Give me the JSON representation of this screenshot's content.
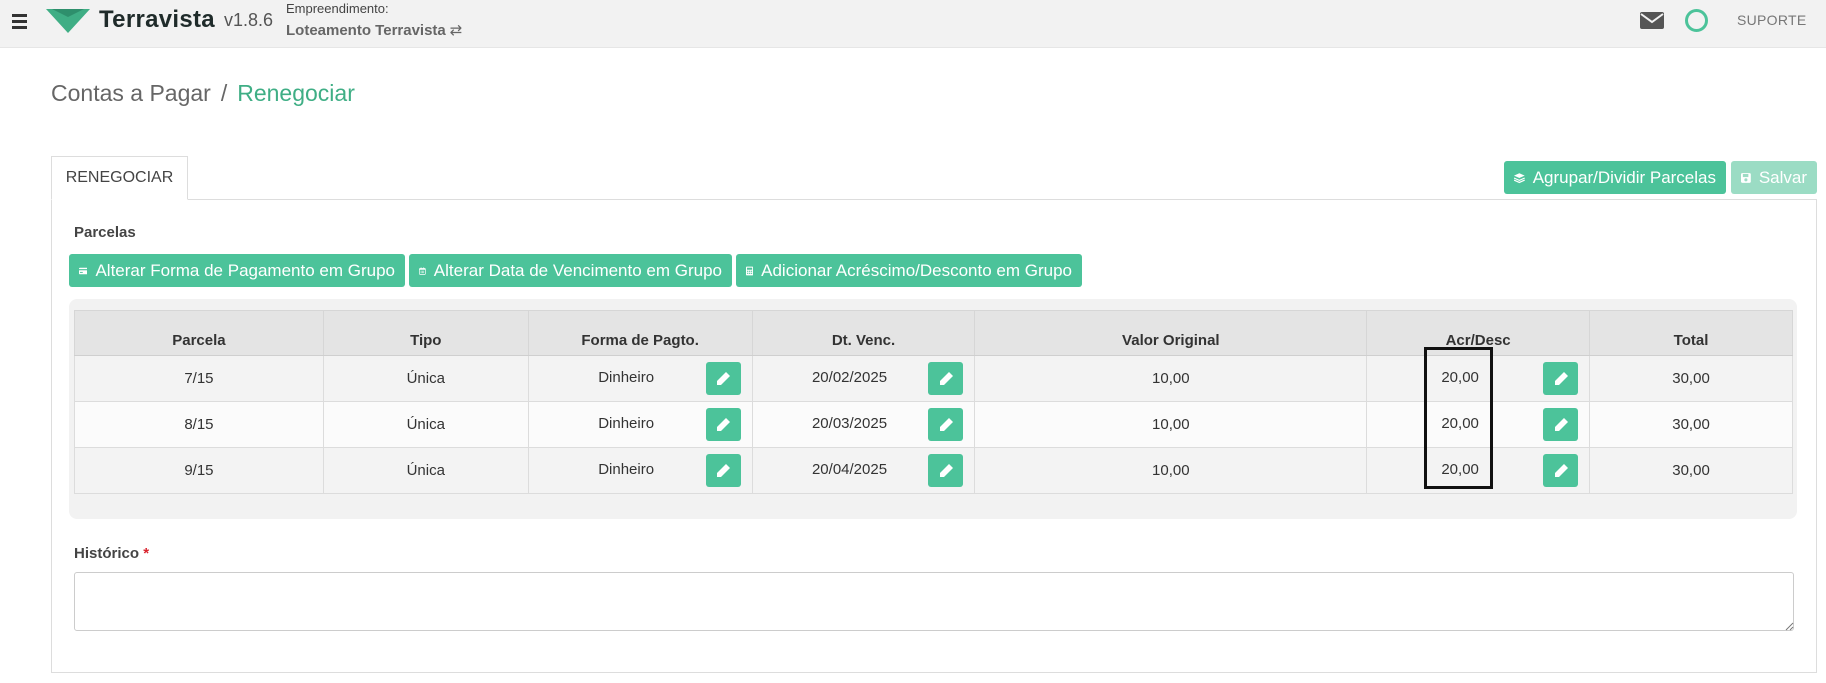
{
  "header": {
    "brand": "Terravista",
    "version": "v1.8.6",
    "empreendimento_label": "Empreendimento:",
    "empreendimento_name": "Loteamento Terravista",
    "swap_glyph": "⇄",
    "support_label": "SUPORTE",
    "accent": "#4cc39a"
  },
  "breadcrumb": {
    "parent": "Contas a Pagar",
    "separator": "/",
    "current": "Renegociar"
  },
  "tabs": [
    {
      "label": "RENEGOCIAR",
      "active": true
    }
  ],
  "actions": {
    "group_label": "Agrupar/Dividir Parcelas",
    "save_label": "Salvar"
  },
  "parcelas": {
    "title": "Parcelas",
    "bulk_payment_label": "Alterar Forma de Pagamento em Grupo",
    "bulk_date_label": "Alterar Data de Vencimento em Grupo",
    "bulk_adjust_label": "Adicionar Acréscimo/Desconto em Grupo"
  },
  "table": {
    "columns": [
      "Parcela",
      "Tipo",
      "Forma de Pagto.",
      "Dt. Venc.",
      "Valor Original",
      "Acr/Desc",
      "Total"
    ],
    "rows": [
      {
        "parcela": "7/15",
        "tipo": "Única",
        "forma": "Dinheiro",
        "vencimento": "20/02/2025",
        "valor": "10,00",
        "acrdesc": "20,00",
        "total": "30,00"
      },
      {
        "parcela": "8/15",
        "tipo": "Única",
        "forma": "Dinheiro",
        "vencimento": "20/03/2025",
        "valor": "10,00",
        "acrdesc": "20,00",
        "total": "30,00"
      },
      {
        "parcela": "9/15",
        "tipo": "Única",
        "forma": "Dinheiro",
        "vencimento": "20/04/2025",
        "valor": "10,00",
        "acrdesc": "20,00",
        "total": "30,00"
      }
    ]
  },
  "historico": {
    "label": "Histórico",
    "required_mark": "*",
    "value": ""
  }
}
